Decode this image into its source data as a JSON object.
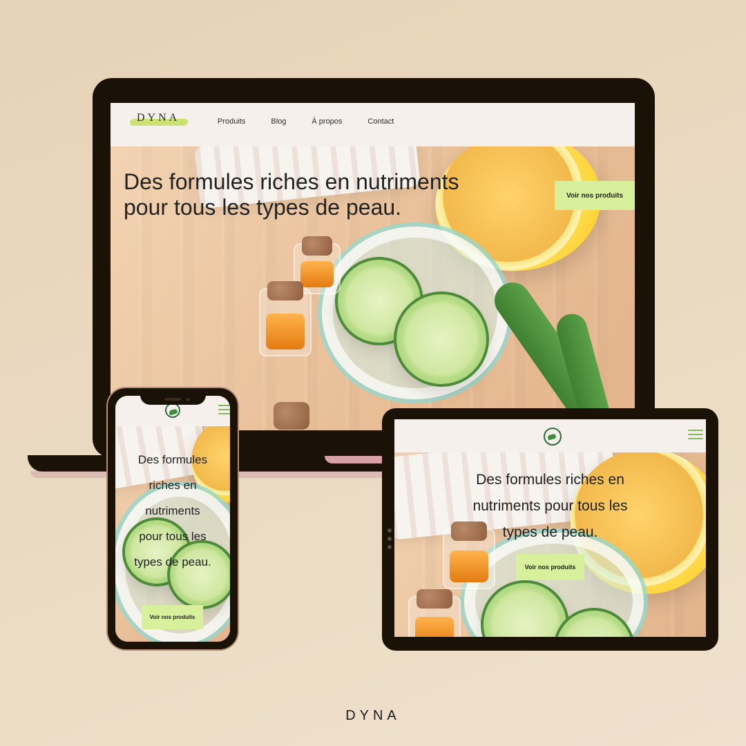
{
  "desktop": {
    "nav": {
      "logo_text": "DYNA",
      "links": [
        "Produits",
        "Blog",
        "À propos",
        "Contact"
      ]
    },
    "hero": {
      "title": "Des formules riches en nutriments pour tous les types de peau.",
      "cta": "Voir nos produits"
    }
  },
  "tablet": {
    "hero": {
      "title": "Des formules riches en nutriments pour tous les types de peau.",
      "cta": "Voir nos produits"
    }
  },
  "phone": {
    "hero": {
      "title": "Des formules riches en nutriments pour tous les types de peau.",
      "cta": "Voir nos produits"
    }
  },
  "footer_brand": "DYNA",
  "colors": {
    "background": "#e8d6bf",
    "device_frame": "#1b1207",
    "accent_button": "#d8f09b",
    "logo_highlight": "#c8e06a",
    "text_dark": "#222222",
    "menu_icon": "#86b85b"
  },
  "icons": {
    "mobile_logo": "leaf-circle-icon",
    "menu": "hamburger-menu-icon"
  }
}
